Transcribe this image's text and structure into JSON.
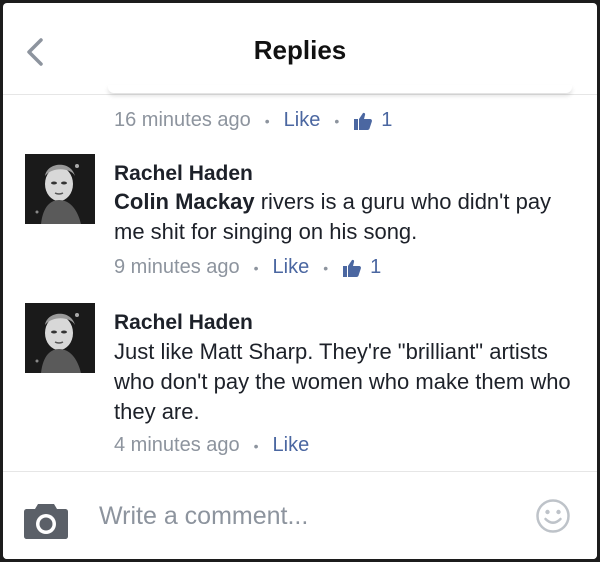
{
  "header": {
    "title": "Replies"
  },
  "top_meta": {
    "time": "16 minutes ago",
    "like_label": "Like",
    "like_count": "1"
  },
  "comments": [
    {
      "author": "Rachel Haden",
      "mention": "Colin Mackay",
      "text": " rivers is a guru who didn't pay me shit for singing on his song.",
      "time": "9 minutes ago",
      "like_label": "Like",
      "like_count": "1"
    },
    {
      "author": "Rachel Haden",
      "text": "Just like Matt Sharp. They're \"brilliant\" artists who don't pay the women who make them who they are.",
      "time": "4 minutes ago",
      "like_label": "Like"
    }
  ],
  "composer": {
    "placeholder": "Write a comment..."
  },
  "icons": {
    "back": "chevron-left-icon",
    "like": "thumbs-up-icon",
    "camera": "camera-icon",
    "emoji": "smiley-icon"
  },
  "colors": {
    "link": "#4b67a1",
    "meta": "#8d949e",
    "text": "#1d2129"
  }
}
